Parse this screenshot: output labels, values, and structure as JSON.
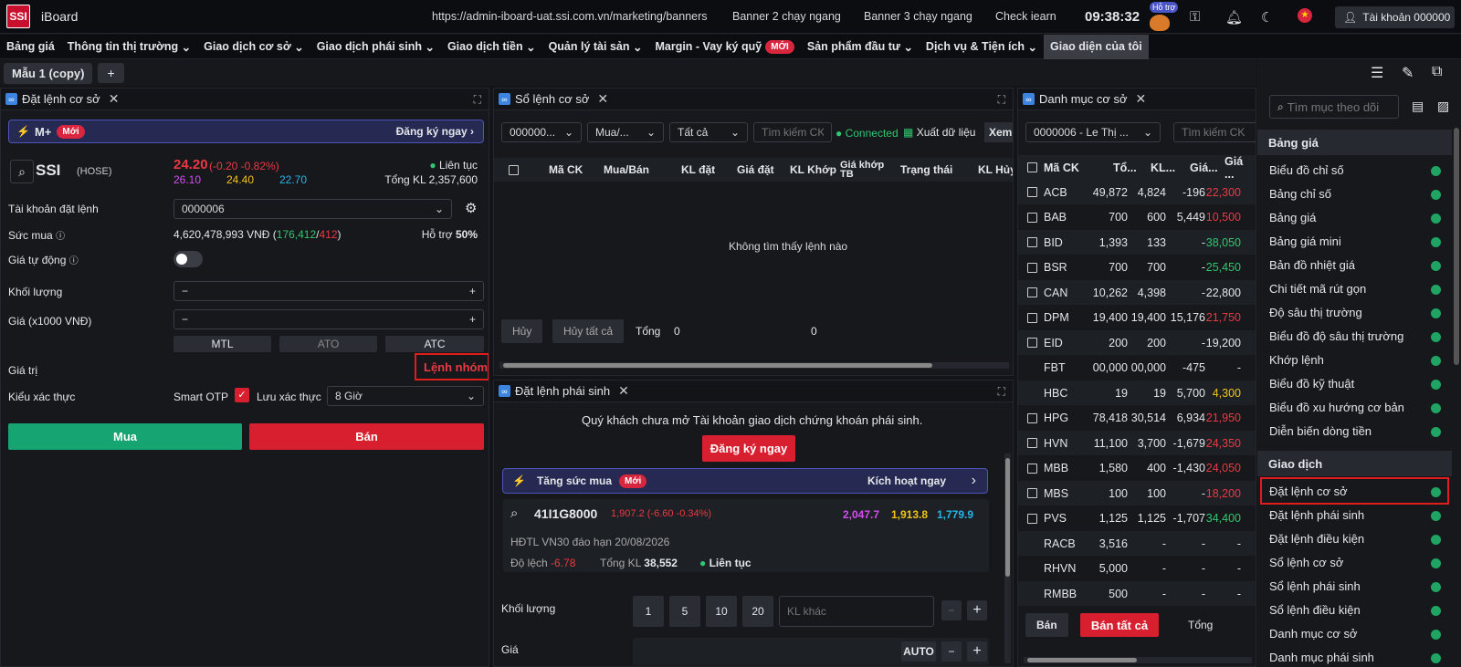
{
  "topbar": {
    "logo": "SSI",
    "app": "iBoard",
    "links": [
      "https://admin-iboard-uat.ssi.com.vn/marketing/banners",
      "Banner 2 chạy ngang",
      "Banner 3 chạy ngang",
      "Check iearn"
    ],
    "clock": "09:38:32",
    "help": "Hỗ trợ",
    "account": "Tài khoản 000000"
  },
  "menu": {
    "items": [
      "Bảng giá",
      "Thông tin thị trường",
      "Giao dịch cơ sở",
      "Giao dịch phái sinh",
      "Giao dịch tiền",
      "Quản lý tài sản",
      "Margin - Vay ký quỹ",
      "Sản phẩm đầu tư",
      "Dịch vụ & Tiện ích",
      "Giao diện của tôi"
    ],
    "new_badge": "MỚI"
  },
  "workspace": {
    "tab": "Mẫu 1 (copy)",
    "plus": "+"
  },
  "order": {
    "title": "Đặt lệnh cơ sở",
    "mplus": "M+",
    "mplus_badge": "Mới",
    "register": "Đăng ký ngay",
    "symbol": "SSI",
    "exchange": "(HOSE)",
    "price": "24.20",
    "change": "(-0.20 -0.82%)",
    "ceil": "26.10",
    "ref": "24.40",
    "floor": "22.70",
    "session": "Liên tục",
    "total_vol_label": "Tổng KL",
    "total_vol": "2,357,600",
    "account_label": "Tài khoản đặt lệnh",
    "account": "0000006",
    "buying_power_label": "Sức mua",
    "buying_power": "4,620,478,993 VNĐ",
    "bp_green": "176,412",
    "bp_red": "412",
    "support_label": "Hỗ trợ",
    "support": "50%",
    "auto_price_label": "Giá tự động",
    "qty_label": "Khối lượng",
    "price_label": "Giá (x1000 VNĐ)",
    "mtl": "MTL",
    "ato": "ATO",
    "atc": "ATC",
    "value_label": "Giá trị",
    "group_order": "Lệnh nhóm",
    "auth_label": "Kiểu xác thực",
    "smart_otp": "Smart OTP",
    "save_auth": "Lưu xác thực",
    "auth_period": "8 Giờ",
    "buy": "Mua",
    "sell": "Bán"
  },
  "book": {
    "title": "Sổ lệnh cơ sở",
    "filter_account": "000000...",
    "filter_side": "Mua/...",
    "filter_status": "Tất cả",
    "search_placeholder": "Tìm kiếm CK",
    "connected": "Connected",
    "export": "Xuất dữ liệu",
    "view": "Xem",
    "columns": [
      "Mã CK",
      "Mua/Bán",
      "KL đặt",
      "Giá đặt",
      "KL Khớp",
      "Giá khớp TB",
      "Trạng thái",
      "KL Hủy"
    ],
    "empty": "Không tìm thấy lệnh nào",
    "cancel": "Hủy",
    "cancel_all": "Hủy tất cả",
    "total_label": "Tổng",
    "total1": "0",
    "total2": "0"
  },
  "deriv": {
    "title": "Đặt lệnh phái sinh",
    "notice": "Quý khách chưa mở Tài khoản giao dịch chứng khoán phái sinh.",
    "register": "Đăng ký ngay",
    "boost": "Tăng sức mua",
    "boost_badge": "Mới",
    "activate": "Kích hoạt ngay",
    "symbol": "41I1G8000",
    "price": "1,907.2 (-6.60 -0.34%)",
    "ceil": "2,047.7",
    "ref": "1,913.8",
    "floor": "1,779.9",
    "desc": "HĐTL VN30 đáo hạn 20/08/2026",
    "basis_label": "Độ lệch",
    "basis": "-6.78",
    "vol_label": "Tổng KL",
    "vol": "38,552",
    "session": "Liên tục",
    "qty_label": "Khối lượng",
    "qty_presets": [
      "1",
      "5",
      "10",
      "20"
    ],
    "qty_other": "KL khác",
    "price_label": "Giá",
    "auto": "AUTO"
  },
  "portfolio": {
    "title": "Danh mục cơ sở",
    "account": "0000006 - Le Thị ...",
    "search_placeholder": "Tìm kiếm CK",
    "columns": [
      "Mã CK",
      "Tổ...",
      "KL...",
      "Giá...",
      "Giá ..."
    ],
    "rows": [
      {
        "sym": "ACB",
        "c": true,
        "a": "49,872",
        "b": "4,824",
        "d": "-196",
        "e": "22,300",
        "ec": "red"
      },
      {
        "sym": "BAB",
        "c": true,
        "a": "700",
        "b": "600",
        "d": "5,449",
        "e": "10,500",
        "ec": "red"
      },
      {
        "sym": "BID",
        "c": true,
        "a": "1,393",
        "b": "133",
        "d": "-",
        "e": "38,050",
        "ec": "green"
      },
      {
        "sym": "BSR",
        "c": true,
        "a": "700",
        "b": "700",
        "d": "-",
        "e": "25,450",
        "ec": "green"
      },
      {
        "sym": "CAN",
        "c": true,
        "a": "10,262",
        "b": "4,398",
        "d": "-",
        "e": "22,800",
        "ec": "white"
      },
      {
        "sym": "DPM",
        "c": true,
        "a": "19,400",
        "b": "19,400",
        "d": "15,176",
        "e": "21,750",
        "ec": "red"
      },
      {
        "sym": "EID",
        "c": true,
        "a": "200",
        "b": "200",
        "d": "-",
        "e": "19,200",
        "ec": "white"
      },
      {
        "sym": "FBT",
        "c": false,
        "a": "00,000",
        "b": "00,000",
        "d": "-475",
        "e": "-",
        "ec": "white"
      },
      {
        "sym": "HBC",
        "c": false,
        "a": "19",
        "b": "19",
        "d": "5,700",
        "e": "4,300",
        "ec": "yellow"
      },
      {
        "sym": "HPG",
        "c": true,
        "a": "78,418",
        "b": "30,514",
        "d": "6,934",
        "e": "21,950",
        "ec": "red"
      },
      {
        "sym": "HVN",
        "c": true,
        "a": "11,100",
        "b": "3,700",
        "d": "-1,679",
        "e": "24,350",
        "ec": "red"
      },
      {
        "sym": "MBB",
        "c": true,
        "a": "1,580",
        "b": "400",
        "d": "-1,430",
        "e": "24,050",
        "ec": "red"
      },
      {
        "sym": "MBS",
        "c": true,
        "a": "100",
        "b": "100",
        "d": "-",
        "e": "18,200",
        "ec": "red"
      },
      {
        "sym": "PVS",
        "c": true,
        "a": "1,125",
        "b": "1,125",
        "d": "-1,707",
        "e": "34,400",
        "ec": "green"
      },
      {
        "sym": "RACB",
        "c": false,
        "a": "3,516",
        "b": "-",
        "d": "-",
        "e": "-",
        "ec": "white"
      },
      {
        "sym": "RHVN",
        "c": false,
        "a": "5,000",
        "b": "-",
        "d": "-",
        "e": "-",
        "ec": "white"
      },
      {
        "sym": "RMBB",
        "c": false,
        "a": "500",
        "b": "-",
        "d": "-",
        "e": "-",
        "ec": "white"
      }
    ],
    "sell": "Bán",
    "sell_all": "Bán tất cả",
    "total": "Tổng"
  },
  "sidebar": {
    "search_placeholder": "Tìm mục theo dõi",
    "groups": [
      {
        "title": "Bảng giá",
        "items": [
          "Biểu đồ chỉ số",
          "Bảng chỉ số",
          "Bảng giá",
          "Bảng giá mini",
          "Bản đồ nhiệt giá",
          "Chi tiết mã rút gọn",
          "Độ sâu thị trường",
          "Biểu đồ độ sâu thị trường",
          "Khớp lệnh",
          "Biểu đồ kỹ thuật",
          "Biểu đồ xu hướng cơ bản",
          "Diễn biến dòng tiền"
        ]
      },
      {
        "title": "Giao dịch",
        "items": [
          "Đặt lệnh cơ sở",
          "Đặt lệnh phái sinh",
          "Đặt lệnh điều kiện",
          "Sổ lệnh cơ sở",
          "Sổ lệnh phái sinh",
          "Sổ lệnh điều kiện",
          "Danh mục cơ sở",
          "Danh mục phái sinh"
        ]
      }
    ]
  },
  "colors": {
    "green": "#2fc770",
    "red": "#ea3943",
    "yellow": "#f0c419",
    "accent": "#d71f2f"
  }
}
